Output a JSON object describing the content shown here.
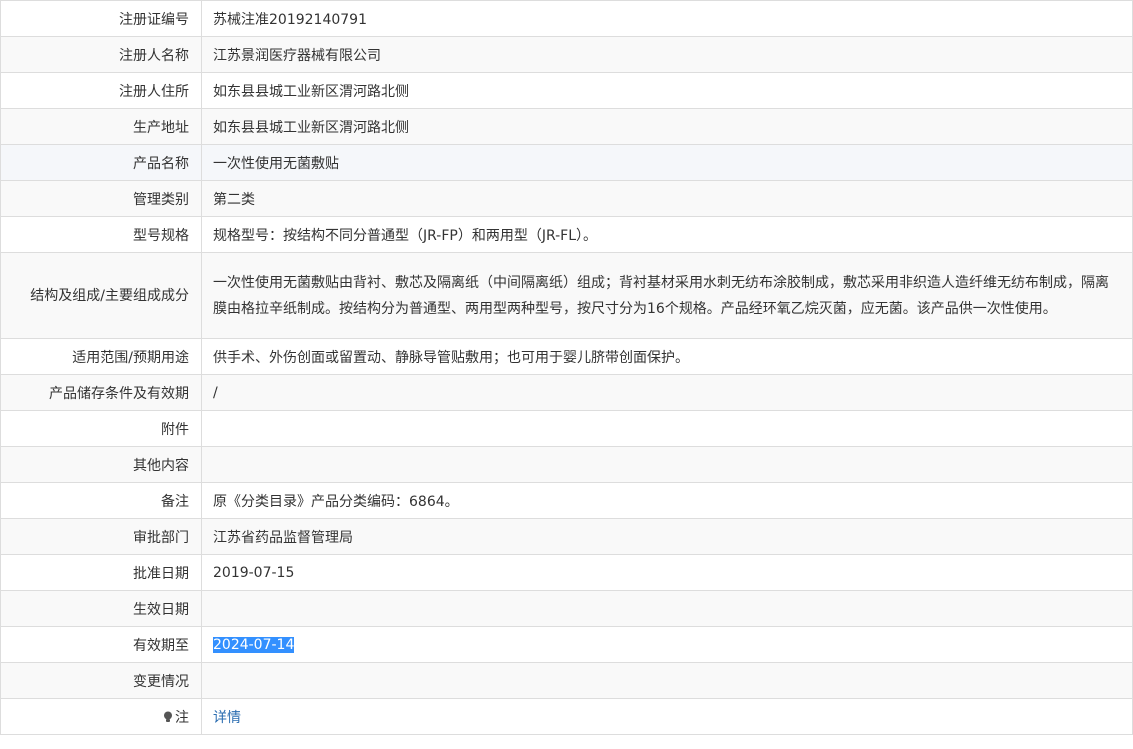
{
  "rows": [
    {
      "label": "注册证编号",
      "value": "苏械注准20192140791"
    },
    {
      "label": "注册人名称",
      "value": "江苏景润医疗器械有限公司"
    },
    {
      "label": "注册人住所",
      "value": "如东县县城工业新区渭河路北侧"
    },
    {
      "label": "生产地址",
      "value": "如东县县城工业新区渭河路北侧"
    },
    {
      "label": "产品名称",
      "value": "一次性使用无菌敷贴"
    },
    {
      "label": "管理类别",
      "value": "第二类"
    },
    {
      "label": "型号规格",
      "value": "规格型号：按结构不同分普通型（JR-FP）和两用型（JR-FL）。"
    },
    {
      "label": "结构及组成/主要组成成分",
      "value": "一次性使用无菌敷贴由背衬、敷芯及隔离纸（中间隔离纸）组成；背衬基材采用水刺无纺布涂胶制成，敷芯采用非织造人造纤维无纺布制成，隔离膜由格拉辛纸制成。按结构分为普通型、两用型两种型号，按尺寸分为16个规格。产品经环氧乙烷灭菌，应无菌。该产品供一次性使用。"
    },
    {
      "label": "适用范围/预期用途",
      "value": "供手术、外伤创面或留置动、静脉导管贴敷用；也可用于婴儿脐带创面保护。"
    },
    {
      "label": "产品储存条件及有效期",
      "value": "/"
    },
    {
      "label": "附件",
      "value": ""
    },
    {
      "label": "其他内容",
      "value": ""
    },
    {
      "label": "备注",
      "value": "原《分类目录》产品分类编码：6864。"
    },
    {
      "label": "审批部门",
      "value": "江苏省药品监督管理局"
    },
    {
      "label": "批准日期",
      "value": "2019-07-15"
    },
    {
      "label": "生效日期",
      "value": ""
    },
    {
      "label": "有效期至",
      "value": "2024-07-14"
    },
    {
      "label": "变更情况",
      "value": ""
    },
    {
      "label": "注",
      "value": "详情"
    }
  ],
  "note_icon": "lightbulb-icon"
}
